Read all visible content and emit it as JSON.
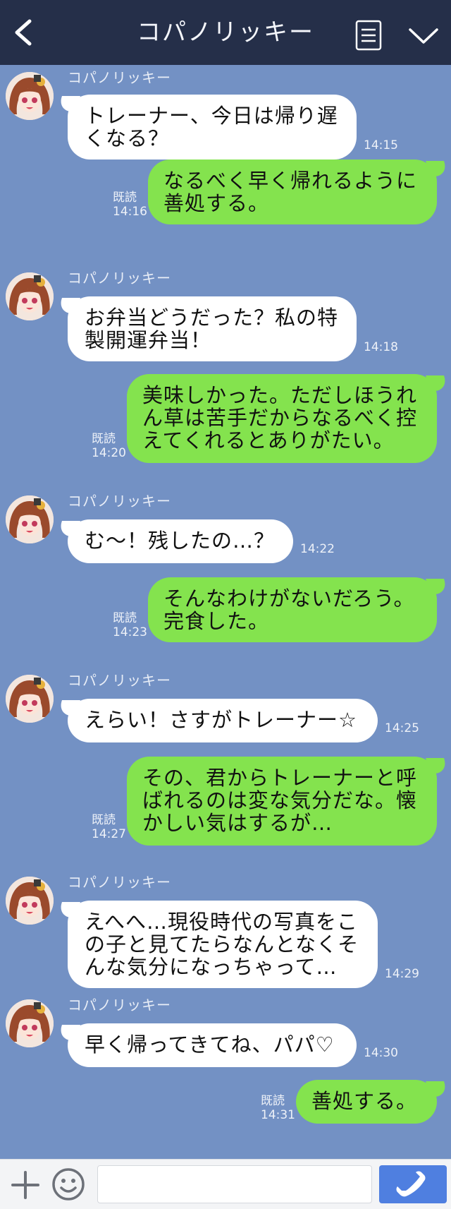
{
  "header": {
    "title": "コパノリッキー"
  },
  "sender_name": "コパノリッキー",
  "read_label": "既読",
  "messages": [
    {
      "direction": "in",
      "text": "トレーナー、今日は帰り遅くなる？",
      "time": "14:15"
    },
    {
      "direction": "out",
      "text": "なるべく早く帰れるように善処する。",
      "time": "14:16",
      "read": "既読"
    },
    {
      "direction": "in",
      "text": "お弁当どうだった？私の特製開運弁当！",
      "time": "14:18"
    },
    {
      "direction": "out",
      "text": "美味しかった。ただしほうれん草は苦手だからなるべく控えてくれるとありがたい。",
      "time": "14:20",
      "read": "既読"
    },
    {
      "direction": "in",
      "text": "む〜！残したの…？",
      "time": "14:22"
    },
    {
      "direction": "out",
      "text": "そんなわけがないだろう。完食した。",
      "time": "14:23",
      "read": "既読"
    },
    {
      "direction": "in",
      "text": "えらい！さすがトレーナー☆",
      "time": "14:25"
    },
    {
      "direction": "out",
      "text": "その、君からトレーナーと呼ばれるのは変な気分だな。懐かしい気はするが…",
      "time": "14:27",
      "read": "既読"
    },
    {
      "direction": "in",
      "text": "えへへ…現役時代の写真をこの子と見てたらなんとなくそんな気分になっちゃって…",
      "time": "14:29"
    },
    {
      "direction": "in",
      "text": "早く帰ってきてね、パパ♡",
      "time": "14:30"
    },
    {
      "direction": "out",
      "text": "善処する。",
      "time": "14:31",
      "read": "既読"
    }
  ],
  "footer": {
    "input_value": "",
    "input_placeholder": ""
  },
  "colors": {
    "header_bg": "#252f49",
    "chat_bg": "#7391c4",
    "incoming_bubble": "#ffffff",
    "outgoing_bubble": "#84e34e",
    "call_button": "#4f7fe0"
  },
  "icons": [
    "back-arrow-icon",
    "menu-icon",
    "chevron-down-icon",
    "plus-icon",
    "smile-icon",
    "phone-icon"
  ]
}
